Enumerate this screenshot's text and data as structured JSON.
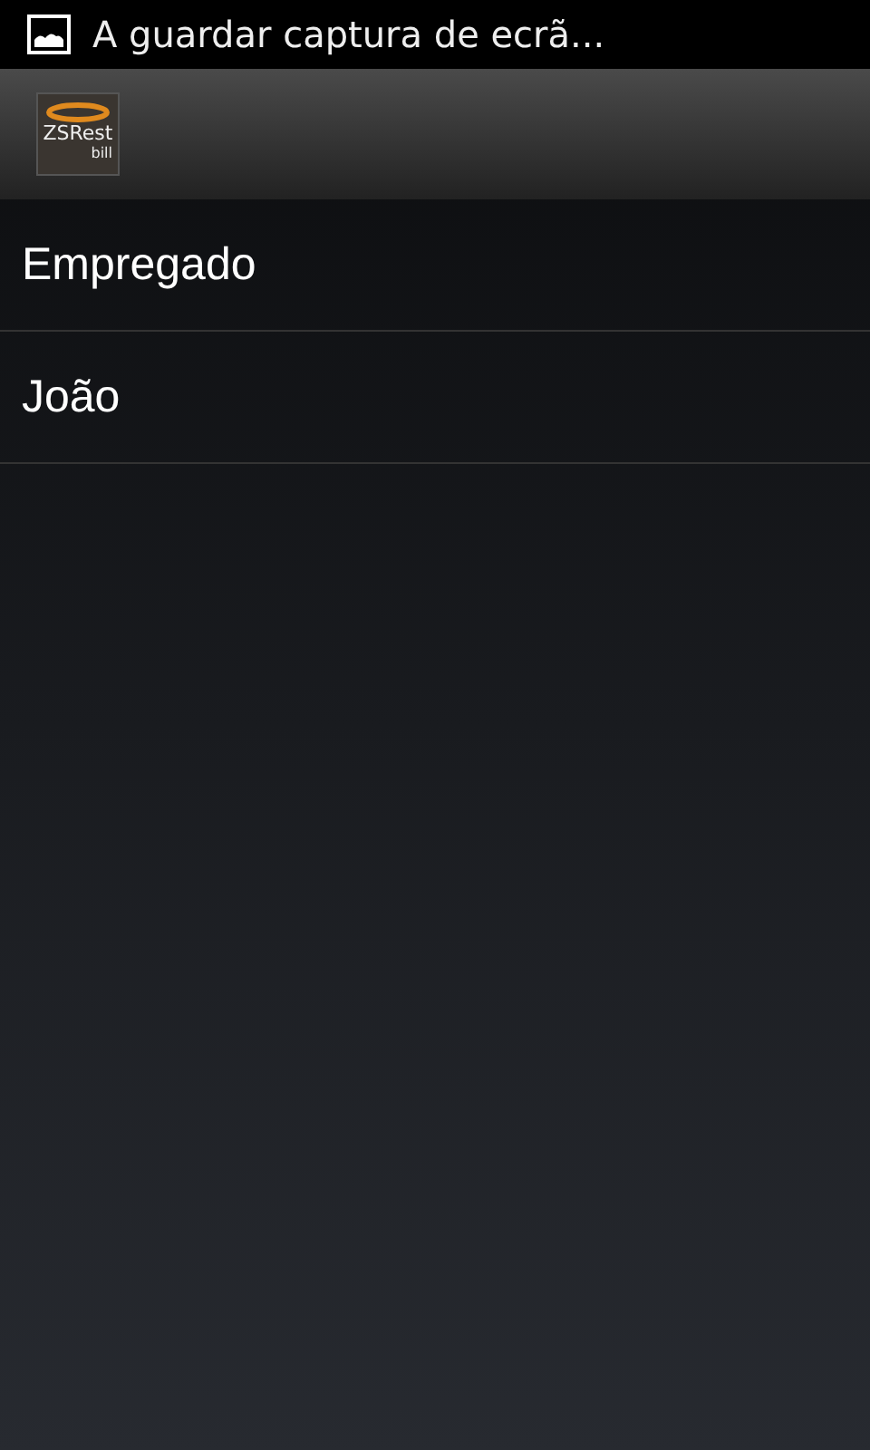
{
  "status_bar": {
    "notification": "A guardar captura de ecrã..."
  },
  "action_bar": {
    "logo": {
      "title": "ZSRest",
      "subtitle": "bill"
    }
  },
  "list": {
    "items": [
      {
        "label": "Empregado"
      },
      {
        "label": "João"
      }
    ]
  }
}
